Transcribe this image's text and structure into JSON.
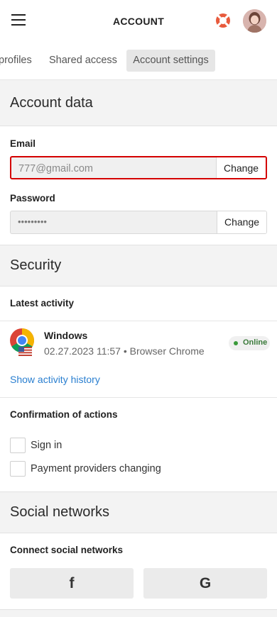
{
  "header": {
    "title": "ACCOUNT",
    "menu_icon": "hamburger-icon",
    "support_icon": "lifebuoy-icon",
    "avatar_icon": "avatar"
  },
  "tabs": [
    {
      "label": "profiles"
    },
    {
      "label": "Shared access"
    },
    {
      "label": "Account settings",
      "active": true
    }
  ],
  "account_data": {
    "heading": "Account data",
    "email": {
      "label": "Email",
      "value": "777@gmail.com",
      "button": "Change"
    },
    "password": {
      "label": "Password",
      "value": "•••••••••",
      "button": "Change"
    }
  },
  "security": {
    "heading": "Security",
    "latest_activity_label": "Latest activity",
    "activity": {
      "os": "Windows",
      "details": "02.27.2023 11:57 • Browser Chrome",
      "status": "Online",
      "browser_icon": "chrome-icon",
      "flag_icon": "us-flag-icon"
    },
    "history_link": "Show activity history",
    "confirmation_label": "Confirmation of actions",
    "options": [
      {
        "label": "Sign in",
        "checked": false
      },
      {
        "label": "Payment providers changing",
        "checked": false
      }
    ]
  },
  "social": {
    "heading": "Social networks",
    "connect_label": "Connect social networks",
    "buttons": [
      {
        "icon": "facebook-icon",
        "glyph": "f"
      },
      {
        "icon": "google-icon",
        "glyph": "G"
      }
    ]
  },
  "colors": {
    "accent_link": "#2a7fd0",
    "online_green": "#3a9a3a",
    "highlight_red": "#d40000"
  }
}
